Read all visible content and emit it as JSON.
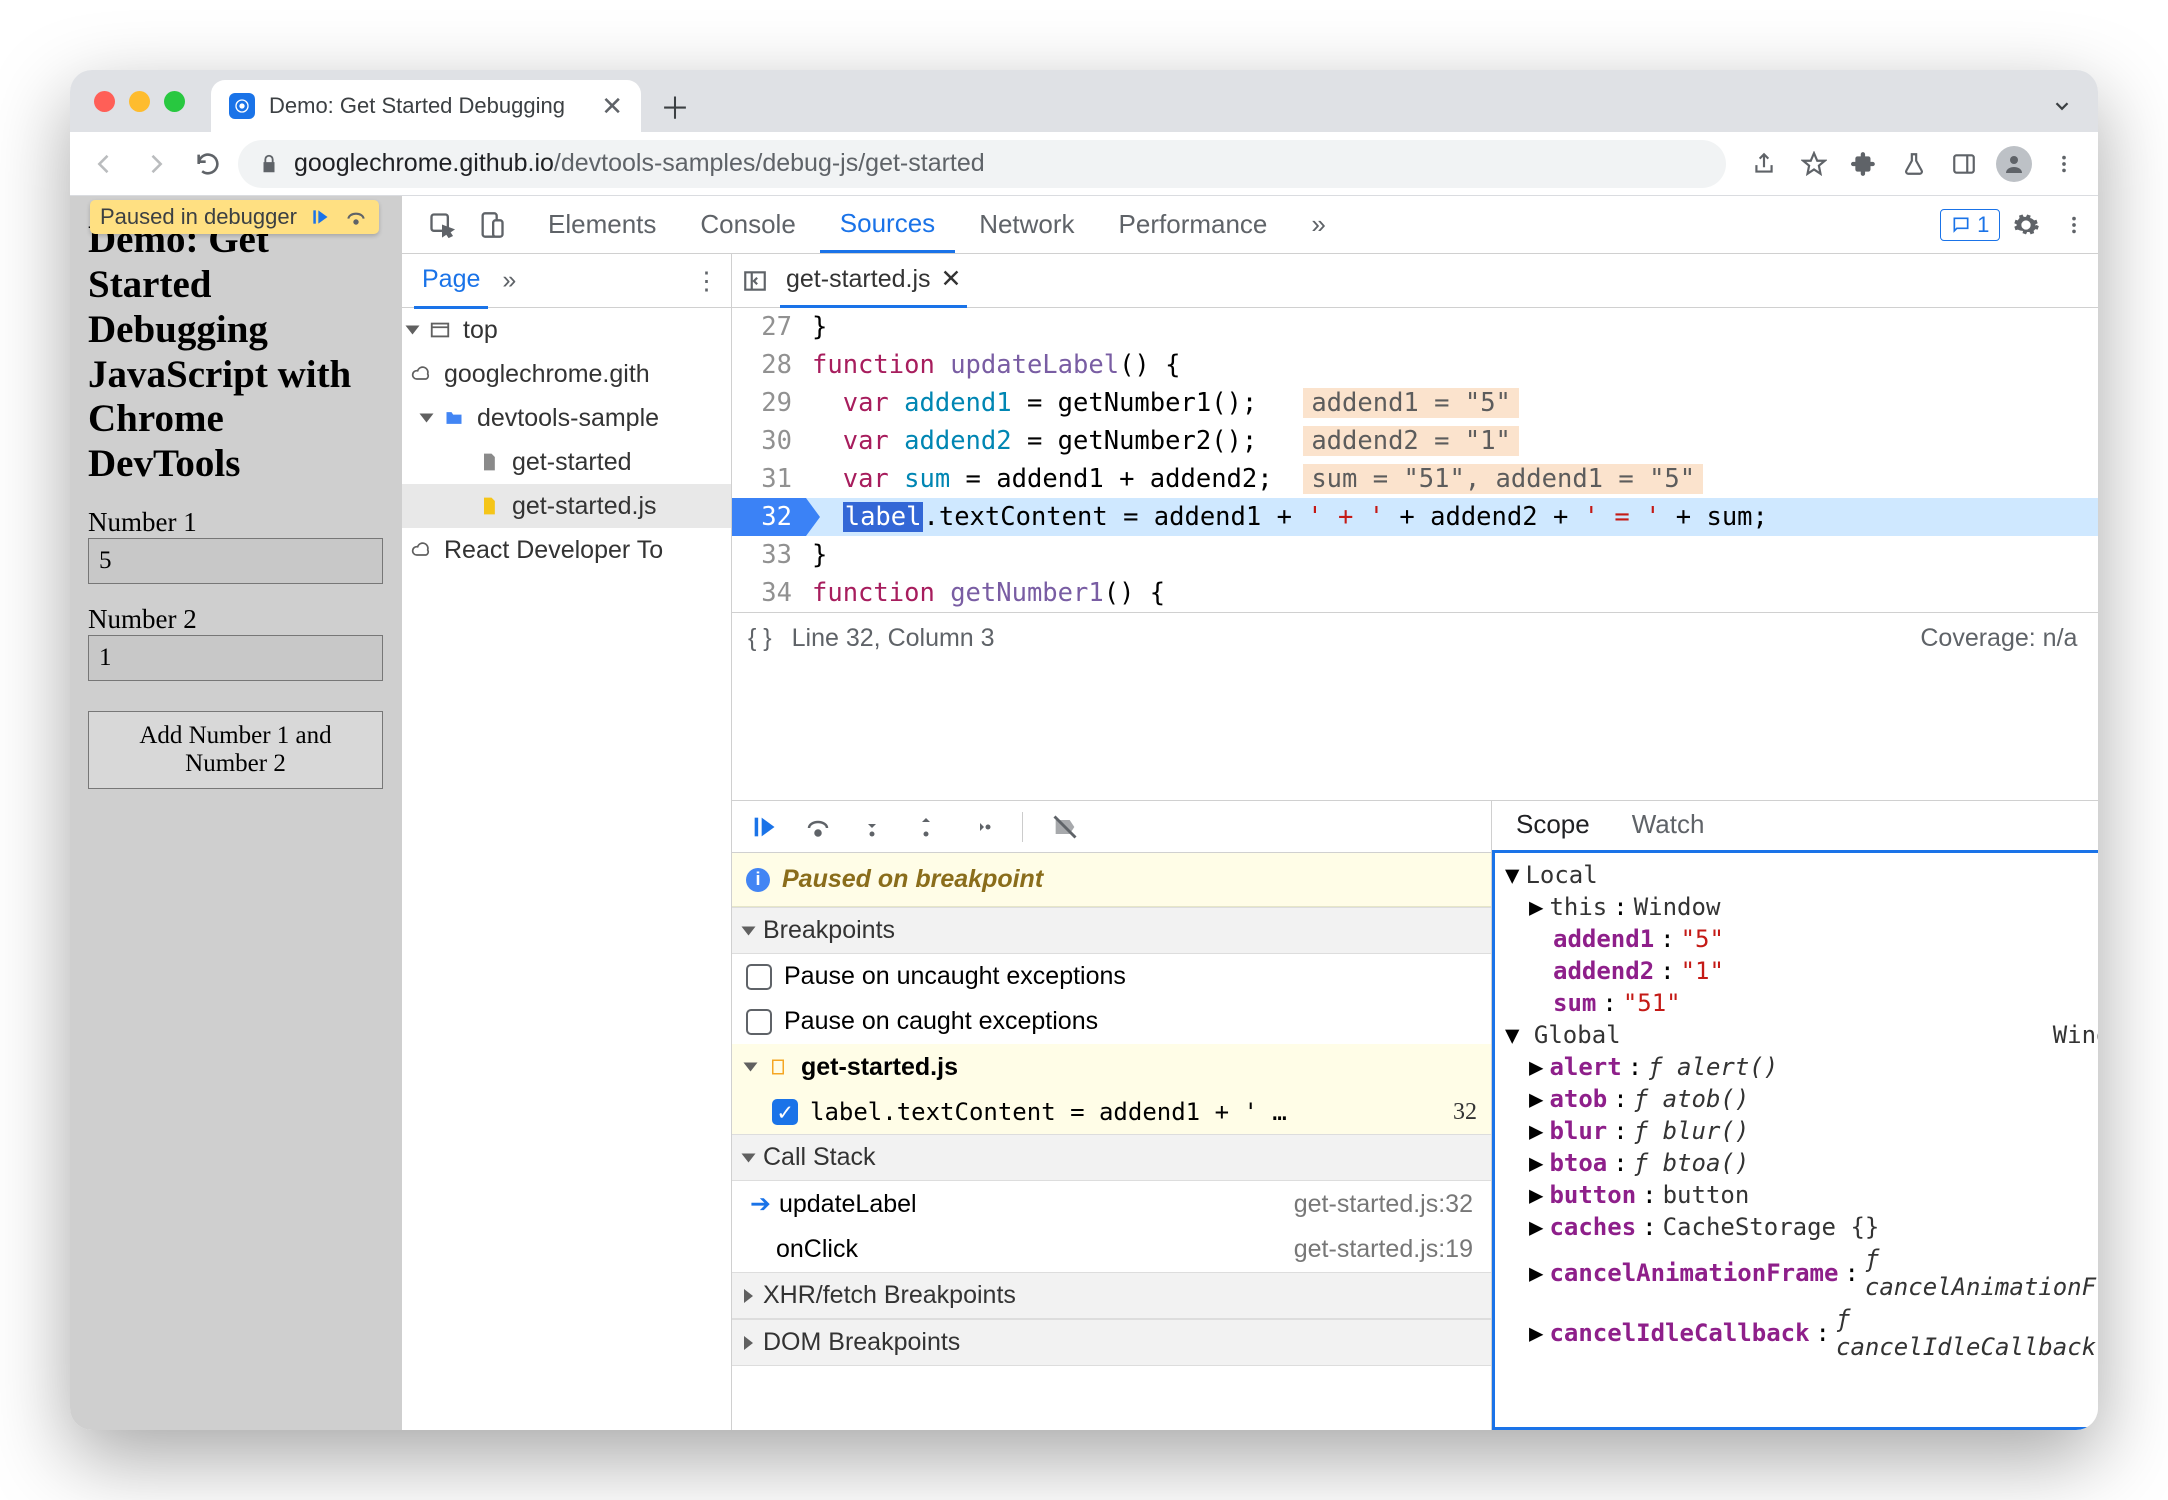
{
  "browser": {
    "tab_title": "Demo: Get Started Debugging",
    "url_host": "googlechrome.github.io",
    "url_path": "/devtools-samples/debug-js/get-started"
  },
  "page": {
    "paused_label": "Paused in debugger",
    "heading": "Demo: Get Started Debugging JavaScript with Chrome DevTools",
    "label1": "Number 1",
    "value1": "5",
    "label2": "Number 2",
    "value2": "1",
    "button": "Add Number 1 and Number 2"
  },
  "devtools": {
    "panels": [
      "Elements",
      "Console",
      "Sources",
      "Network",
      "Performance"
    ],
    "active_panel": "Sources",
    "issues_count": "1",
    "navigator": {
      "tab": "Page",
      "tree": {
        "top": "top",
        "domain": "googlechrome.gith",
        "folder": "devtools-sample",
        "file_html": "get-started",
        "file_js": "get-started.js",
        "ext": "React Developer To"
      }
    },
    "editor": {
      "file": "get-started.js",
      "status": "Line 32, Column 3",
      "coverage": "Coverage: n/a",
      "lines": {
        "l27": "}",
        "l28_a": "function",
        "l28_b": "updateLabel",
        "l28_c": "() {",
        "l29_a": "var",
        "l29_b": "addend1",
        "l29_c": " = getNumber1();",
        "l29_h": "addend1 = \"5\"",
        "l30_a": "var",
        "l30_b": "addend2",
        "l30_c": " = getNumber2();",
        "l30_h": "addend2 = \"1\"",
        "l31_a": "var",
        "l31_b": "sum",
        "l31_c": " = addend1 + addend2;",
        "l31_h": "sum = \"51\", addend1 = \"5\"",
        "l32_a": "label",
        "l32_b": ".textContent = addend1 + ",
        "l32_c": "' + '",
        "l32_d": " + addend2 + ",
        "l32_e": "' = '",
        "l32_f": " + sum;",
        "l33": "}",
        "l34_a": "function",
        "l34_b": "getNumber1",
        "l34_c": "() {"
      }
    },
    "debug": {
      "paused_msg": "Paused on breakpoint",
      "breakpoints_hdr": "Breakpoints",
      "bp_uncaught": "Pause on uncaught exceptions",
      "bp_caught": "Pause on caught exceptions",
      "bp_file": "get-started.js",
      "bp_code": "label.textContent = addend1 + ' …",
      "bp_line": "32",
      "callstack_hdr": "Call Stack",
      "frames": [
        {
          "fn": "updateLabel",
          "loc": "get-started.js:32"
        },
        {
          "fn": "onClick",
          "loc": "get-started.js:19"
        }
      ],
      "xhr_hdr": "XHR/fetch Breakpoints",
      "dom_hdr": "DOM Breakpoints"
    },
    "scope": {
      "tabs": [
        "Scope",
        "Watch"
      ],
      "local_label": "Local",
      "global_label": "Global",
      "global_value": "Window",
      "local": {
        "this_k": "this",
        "this_v": "Window",
        "a1_k": "addend1",
        "a1_v": "\"5\"",
        "a2_k": "addend2",
        "a2_v": "\"1\"",
        "sum_k": "sum",
        "sum_v": "\"51\""
      },
      "globals": [
        {
          "k": "alert",
          "v": "ƒ alert()"
        },
        {
          "k": "atob",
          "v": "ƒ atob()"
        },
        {
          "k": "blur",
          "v": "ƒ blur()"
        },
        {
          "k": "btoa",
          "v": "ƒ btoa()"
        },
        {
          "k": "button",
          "v": "button"
        },
        {
          "k": "caches",
          "v": "CacheStorage {}"
        },
        {
          "k": "cancelAnimationFrame",
          "v": "ƒ cancelAnimationFram"
        },
        {
          "k": "cancelIdleCallback",
          "v": "ƒ cancelIdleCallback()"
        }
      ]
    }
  }
}
